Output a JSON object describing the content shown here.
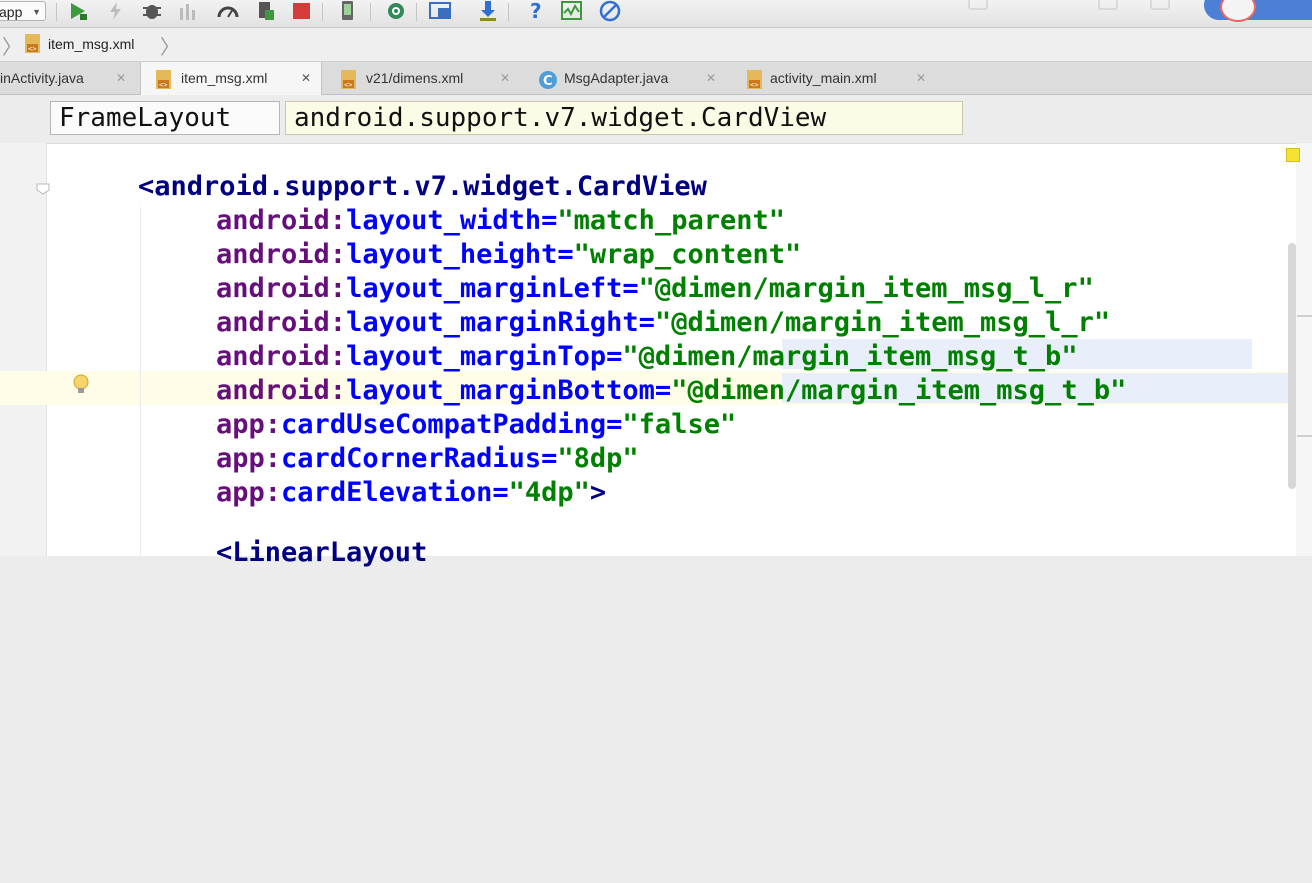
{
  "toolbar": {
    "run_config": "app",
    "icons": [
      "run-icon",
      "apply-changes-icon",
      "debug-icon",
      "attach-debugger-icon",
      "profile-icon",
      "stop-icon-gray",
      "stop-icon",
      "avd-manager-icon",
      "sync-icon",
      "project-structure-icon",
      "sdk-manager-icon",
      "help-icon",
      "monitor-icon",
      "no-entry-icon"
    ],
    "accent_colors": {
      "run": "#3c9a3c",
      "stop": "#d63a3a",
      "help": "#2f6fd6"
    }
  },
  "breadcrumb": {
    "file": "item_msg.xml"
  },
  "tabs": [
    {
      "label": "inActivity.java",
      "icon": "java-class-icon",
      "active": false
    },
    {
      "label": "item_msg.xml",
      "icon": "xml-file-icon",
      "active": true
    },
    {
      "label": "v21/dimens.xml",
      "icon": "xml-file-icon",
      "active": false
    },
    {
      "label": "MsgAdapter.java",
      "icon": "java-class-icon",
      "active": false
    },
    {
      "label": "activity_main.xml",
      "icon": "xml-file-icon",
      "active": false
    }
  ],
  "editor_breadcrumb": [
    "FrameLayout",
    "android.support.v7.widget.CardView"
  ],
  "code": {
    "open_tag": "<android.support.v7.widget.CardView",
    "attributes": [
      {
        "ns": "android",
        "name": "layout_width",
        "value": "\"match_parent\""
      },
      {
        "ns": "android",
        "name": "layout_height",
        "value": "\"wrap_content\""
      },
      {
        "ns": "android",
        "name": "layout_marginLeft",
        "value": "\"@dimen/margin_item_msg_l_r\""
      },
      {
        "ns": "android",
        "name": "layout_marginRight",
        "value": "\"@dimen/margin_item_msg_l_r\""
      },
      {
        "ns": "android",
        "name": "layout_marginTop",
        "value": "\"@dimen/margin_item_msg_t_b\""
      },
      {
        "ns": "android",
        "name": "layout_marginBottom",
        "value": "\"@dimen/margin_item_msg_t_b\""
      },
      {
        "ns": "app",
        "name": "cardUseCompatPadding",
        "value": "\"false\""
      },
      {
        "ns": "app",
        "name": "cardCornerRadius",
        "value": "\"8dp\""
      },
      {
        "ns": "app",
        "name": "cardElevation",
        "value": "\"4dp\"",
        "close": ">"
      }
    ],
    "next_line": "<LinearLayout",
    "ns_separator": ":",
    "eq": "="
  },
  "syntax_colors": {
    "tag": "#000080",
    "namespace": "#660e7a",
    "attribute": "#0000ff",
    "value": "#008000"
  }
}
